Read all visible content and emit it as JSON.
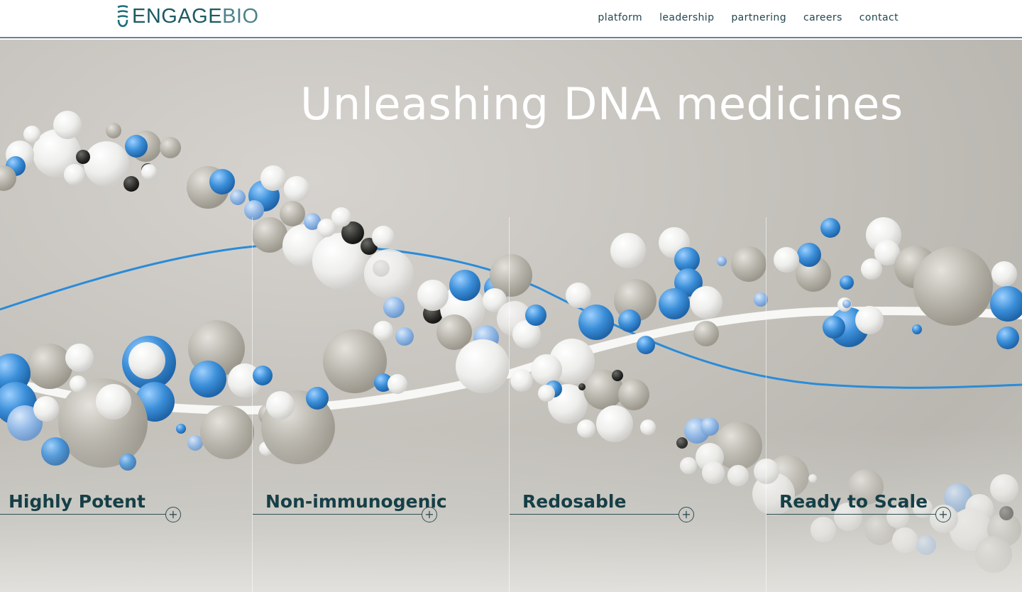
{
  "header": {
    "logo": {
      "engage": "ENGAGE",
      "bio": "BIO"
    },
    "nav": [
      {
        "label": "platform"
      },
      {
        "label": "leadership"
      },
      {
        "label": "partnering"
      },
      {
        "label": "careers"
      },
      {
        "label": "contact"
      }
    ]
  },
  "hero": {
    "headline": "Unleashing DNA medicines",
    "features": [
      {
        "title": "Highly Potent"
      },
      {
        "title": "Non-immunogenic"
      },
      {
        "title": "Redosable"
      },
      {
        "title": "Ready to Scale"
      }
    ],
    "expand_symbol": "+"
  },
  "colors": {
    "brand_teal": "#1c5a63",
    "feature_text": "#163f47",
    "strand_blue": "#2a8bd8",
    "sphere_blue": "#3b8fd9",
    "background": "#c5c2bc"
  }
}
